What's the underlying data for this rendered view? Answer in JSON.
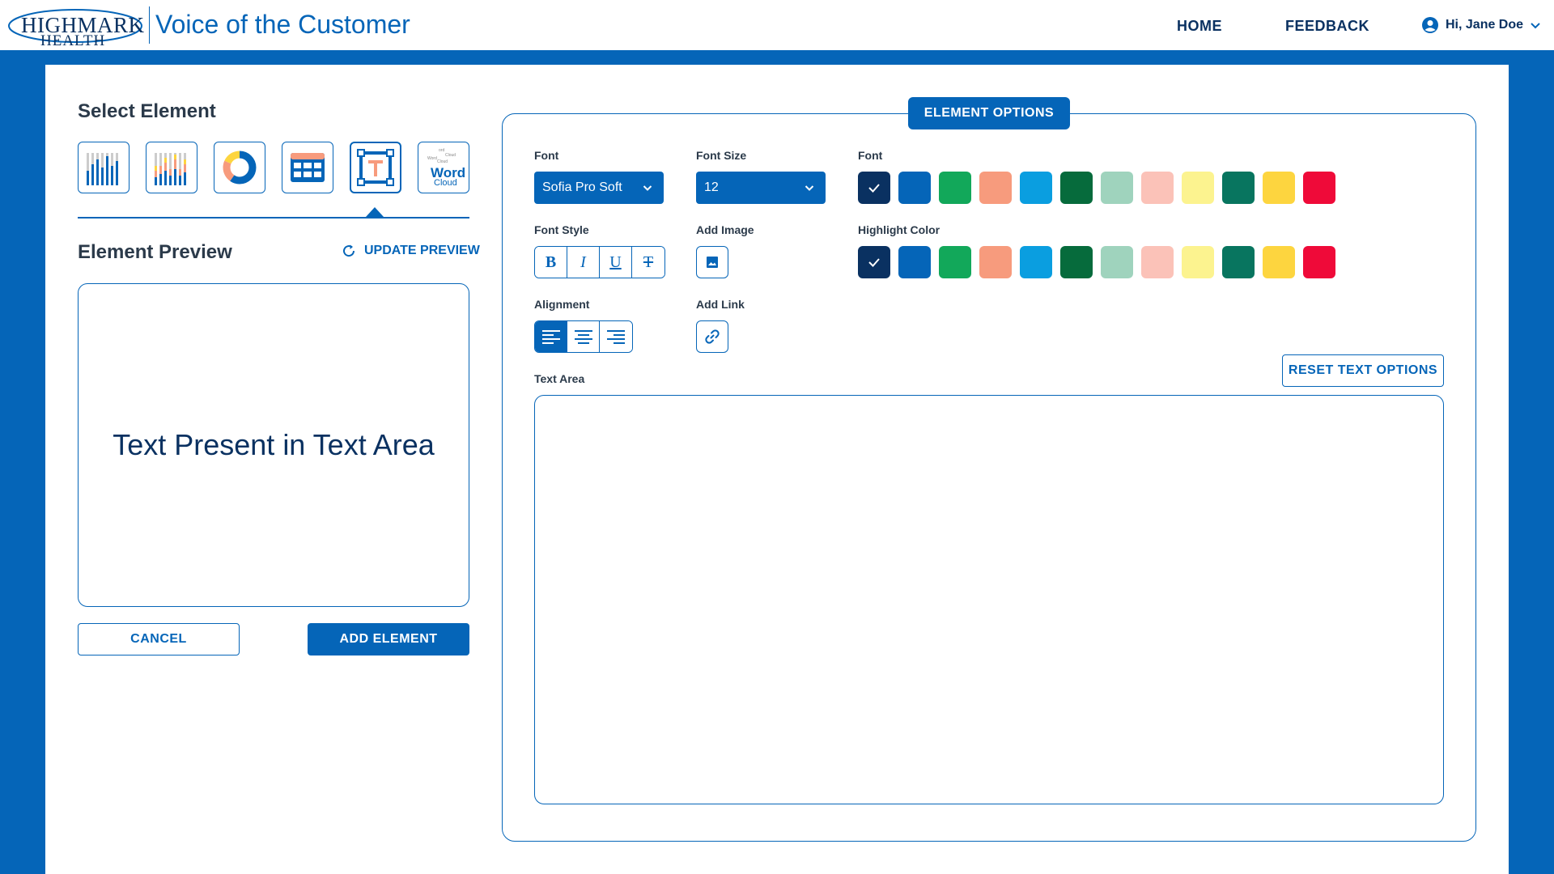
{
  "header": {
    "logo_line1": "HIGHMARK",
    "logo_line2": "HEALTH",
    "app_title": "Voice of the Customer",
    "nav": {
      "home": "HOME",
      "feedback": "FEEDBACK"
    },
    "user": "Hi, Jane Doe"
  },
  "select_element": {
    "title": "Select Element",
    "items": [
      {
        "name": "bar-chart",
        "icon": "bar-chart-icon"
      },
      {
        "name": "stacked-bar-chart",
        "icon": "stacked-bar-chart-icon"
      },
      {
        "name": "donut-chart",
        "icon": "donut-chart-icon"
      },
      {
        "name": "table",
        "icon": "table-icon"
      },
      {
        "name": "text",
        "icon": "text-box-icon",
        "selected": true
      },
      {
        "name": "word-cloud",
        "icon": "word-cloud-icon"
      }
    ],
    "word_cloud_label_1": "Word",
    "word_cloud_label_2": "Cloud"
  },
  "preview": {
    "title": "Element Preview",
    "update_label": "UPDATE PREVIEW",
    "text": "Text Present in Text Area"
  },
  "actions": {
    "cancel": "CANCEL",
    "add": "ADD ELEMENT"
  },
  "options": {
    "tab_label": "ELEMENT OPTIONS",
    "font_label": "Font",
    "font_value": "Sofia Pro Soft",
    "font_size_label": "Font Size",
    "font_size_value": "12",
    "font_color_label": "Font",
    "font_style_label": "Font Style",
    "font_style_buttons": [
      "B",
      "I",
      "U",
      "T"
    ],
    "add_image_label": "Add Image",
    "highlight_label": "Highlight Color",
    "alignment_label": "Alignment",
    "add_link_label": "Add Link",
    "reset_label": "RESET TEXT OPTIONS",
    "text_area_label": "Text Area",
    "text_area_value": "",
    "colors": [
      "#0a3161",
      "#0565b8",
      "#12a85a",
      "#f79b7d",
      "#0a9ee0",
      "#066b3c",
      "#9fd3bd",
      "#fbc2b8",
      "#fcf38f",
      "#08755f",
      "#fdd53f",
      "#ef0a39"
    ]
  }
}
